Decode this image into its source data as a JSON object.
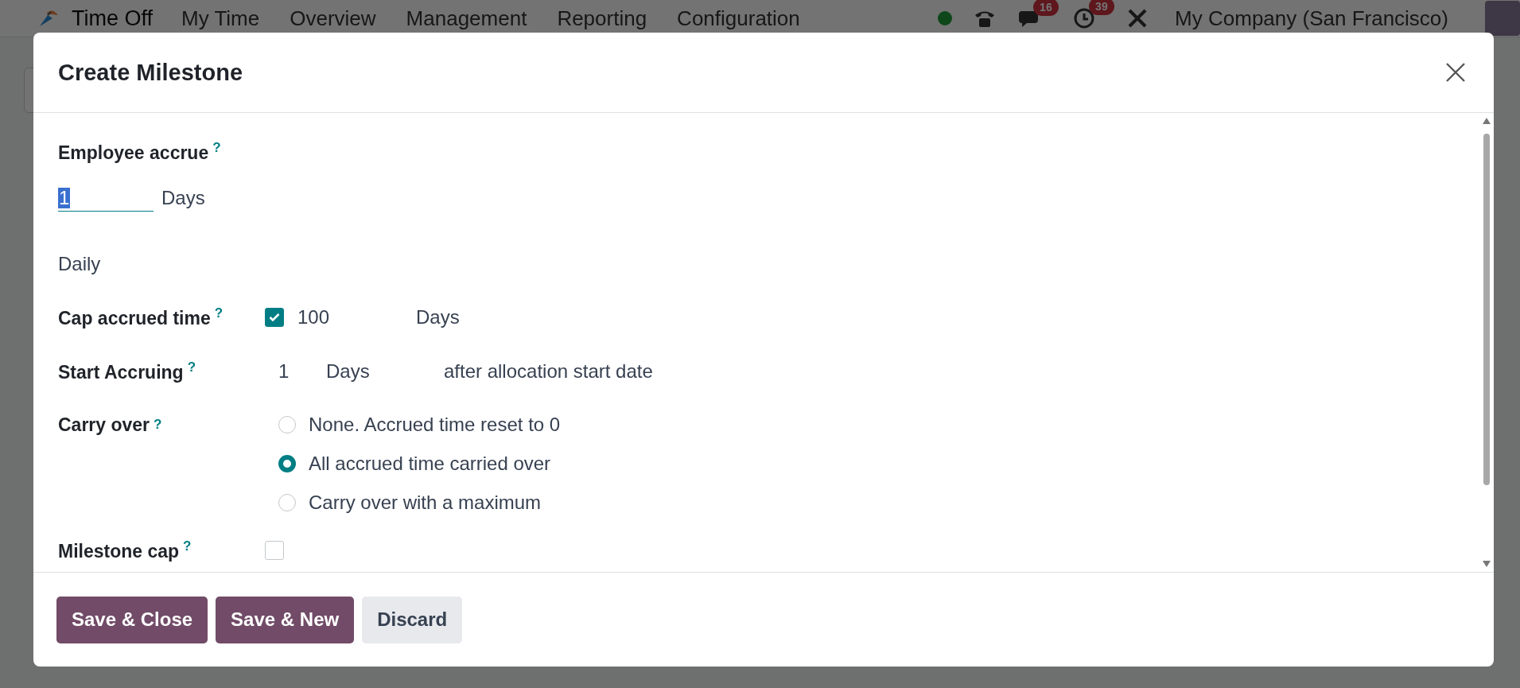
{
  "navbar": {
    "app_name": "Time Off",
    "menu": [
      "My Time",
      "Overview",
      "Management",
      "Reporting",
      "Configuration"
    ],
    "chat_count": "16",
    "activity_count": "39",
    "company": "My Company (San Francisco)"
  },
  "dialog": {
    "title": "Create Milestone",
    "fields": [
      {
        "kind": "amount",
        "label": "Employee accrue",
        "help": "?",
        "value": "1",
        "unit": "Days"
      },
      {
        "kind": "text",
        "value": "Daily"
      },
      {
        "kind": "cap",
        "label": "Cap accrued time",
        "help": "?",
        "checked": true,
        "value": "100",
        "unit": "Days"
      },
      {
        "kind": "start",
        "label": "Start Accruing",
        "help": "?",
        "value": "1",
        "unit": "Days",
        "suffix": "after allocation start date"
      },
      {
        "kind": "radio",
        "label": "Carry over",
        "help": "?",
        "options": [
          {
            "label": "None. Accrued time reset to 0",
            "selected": false
          },
          {
            "label": "All accrued time carried over",
            "selected": true
          },
          {
            "label": "Carry over with a maximum",
            "selected": false
          }
        ]
      },
      {
        "kind": "checkbox",
        "label": "Milestone cap",
        "help": "?",
        "checked": false
      }
    ]
  },
  "buttons": [
    {
      "label": "Save & Close",
      "kind": "primary"
    },
    {
      "label": "Save & New",
      "kind": "primary"
    },
    {
      "label": "Discard",
      "kind": "secondary"
    }
  ]
}
